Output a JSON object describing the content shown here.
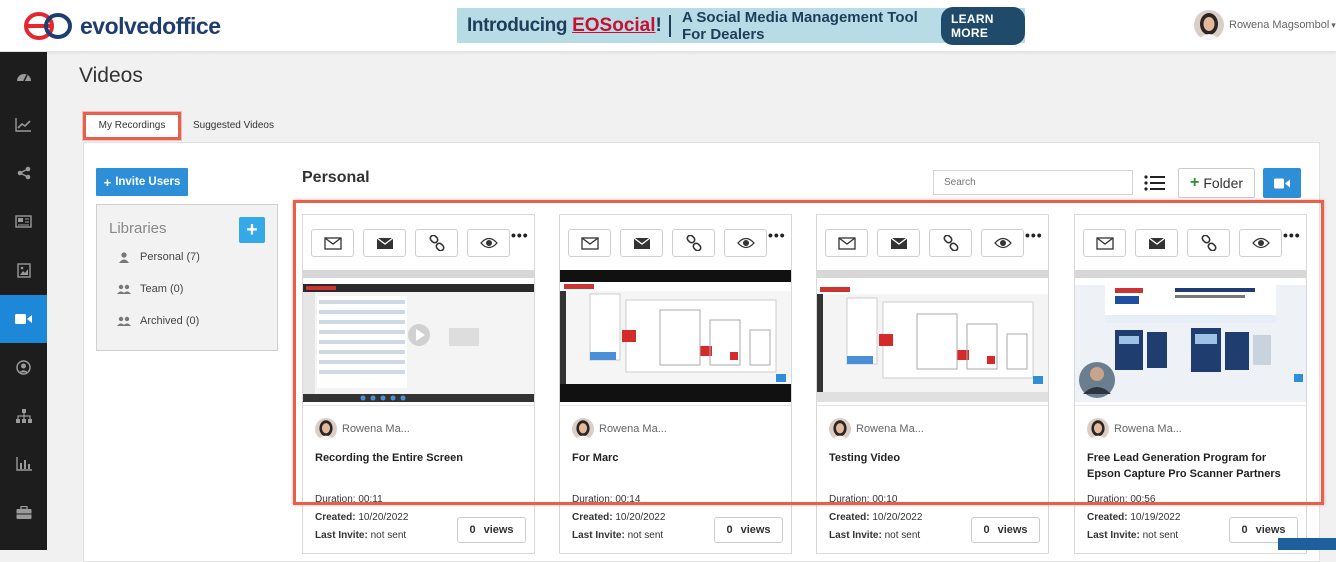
{
  "app": {
    "logo_text": "evolvedoffice",
    "page_title": "Videos"
  },
  "banner": {
    "intro": "Introducing",
    "brand": "EOSocial",
    "tagline": "A Social Media Management Tool For Dealers",
    "cta": "LEARN MORE"
  },
  "user": {
    "name": "Rowena Magsombol"
  },
  "sidebar": {
    "items": [
      {
        "icon": "dashboard-icon"
      },
      {
        "icon": "line-chart-icon"
      },
      {
        "icon": "share-icon"
      },
      {
        "icon": "newspaper-icon"
      },
      {
        "icon": "image-icon"
      },
      {
        "icon": "video-camera-icon",
        "active": true
      },
      {
        "icon": "user-circle-icon"
      },
      {
        "icon": "sitemap-icon"
      },
      {
        "icon": "bar-chart-icon"
      },
      {
        "icon": "briefcase-icon"
      }
    ]
  },
  "tabs": {
    "my_recordings": "My Recordings",
    "suggested": "Suggested Videos"
  },
  "left": {
    "invite_label": "Invite Users",
    "libraries_title": "Libraries",
    "libraries": [
      {
        "label": "Personal (7)"
      },
      {
        "label": "Team (0)"
      },
      {
        "label": "Archived (0)"
      }
    ]
  },
  "main": {
    "section_title": "Personal",
    "search_placeholder": "Search",
    "folder_label": "Folder"
  },
  "labels": {
    "duration": "Duration:",
    "created": "Created:",
    "last_invite": "Last Invite:",
    "views": "views"
  },
  "videos": [
    {
      "author": "Rowena Ma...",
      "title": "Recording the Entire Screen",
      "duration": "00:11",
      "created": "10/20/2022",
      "last_invite": "not sent",
      "views": "0"
    },
    {
      "author": "Rowena Ma...",
      "title": "For Marc",
      "duration": "00:14",
      "created": "10/20/2022",
      "last_invite": "not sent",
      "views": "0"
    },
    {
      "author": "Rowena Ma...",
      "title": "Testing Video",
      "duration": "00:10",
      "created": "10/20/2022",
      "last_invite": "not sent",
      "views": "0"
    },
    {
      "author": "Rowena Ma...",
      "title": "Free Lead Generation Program for Epson Capture Pro Scanner Partners",
      "duration": "00:56",
      "created": "10/19/2022",
      "last_invite": "not sent",
      "views": "0"
    }
  ],
  "colors": {
    "primary": "#2d8fd8",
    "highlight": "#e8604c",
    "sidebar": "#1d1d1d",
    "logo_red": "#e3262f",
    "logo_navy": "#1f3d6e"
  }
}
